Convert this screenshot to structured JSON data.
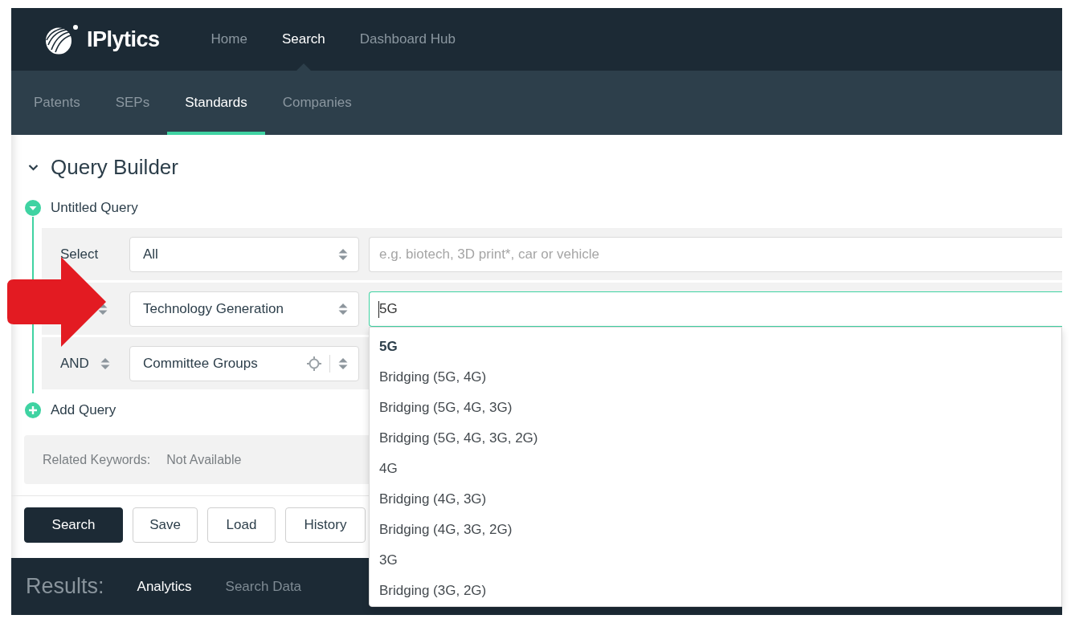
{
  "header": {
    "logo_text": "IPlytics",
    "nav": [
      {
        "label": "Home",
        "selected": false
      },
      {
        "label": "Search",
        "selected": true
      },
      {
        "label": "Dashboard Hub",
        "selected": false
      }
    ]
  },
  "subnav": [
    {
      "label": "Patents",
      "selected": false
    },
    {
      "label": "SEPs",
      "selected": false
    },
    {
      "label": "Standards",
      "selected": true
    },
    {
      "label": "Companies",
      "selected": false
    }
  ],
  "query_builder": {
    "title": "Query Builder",
    "expanded": true,
    "query": {
      "name": "Untitled Query",
      "expanded": true,
      "rows": [
        {
          "kind": "label",
          "label": "Select",
          "field": "All",
          "locate": false,
          "input": {
            "placeholder": "e.g. biotech, 3D print*, car or vehicle",
            "focused": false
          }
        },
        {
          "kind": "operator",
          "field": "Technology Generation",
          "locate": false,
          "input": {
            "value": "5G",
            "focused": true
          }
        },
        {
          "kind": "operator",
          "operator": "AND",
          "field": "Committee Groups",
          "locate": true
        }
      ]
    },
    "add_query": "Add Query",
    "related_keywords": {
      "label": "Related Keywords:",
      "value": "Not Available"
    },
    "buttons": [
      {
        "label": "Search",
        "kind": "primary"
      },
      {
        "label": "Save",
        "kind": "secondary"
      },
      {
        "label": "Load",
        "kind": "secondary"
      },
      {
        "label": "History",
        "kind": "secondary"
      }
    ]
  },
  "suggestions": [
    {
      "label": "5G",
      "selected": true
    },
    {
      "label": "Bridging (5G, 4G)",
      "selected": false
    },
    {
      "label": "Bridging (5G, 4G, 3G)",
      "selected": false
    },
    {
      "label": "Bridging (5G, 4G, 3G, 2G)",
      "selected": false
    },
    {
      "label": "4G",
      "selected": false
    },
    {
      "label": "Bridging (4G, 3G)",
      "selected": false
    },
    {
      "label": "Bridging (4G, 3G, 2G)",
      "selected": false
    },
    {
      "label": "3G",
      "selected": false
    },
    {
      "label": "Bridging (3G, 2G)",
      "selected": false
    }
  ],
  "results": {
    "title": "Results:",
    "tabs": [
      {
        "label": "Analytics",
        "selected": true
      },
      {
        "label": "Search Data",
        "selected": false
      }
    ]
  }
}
